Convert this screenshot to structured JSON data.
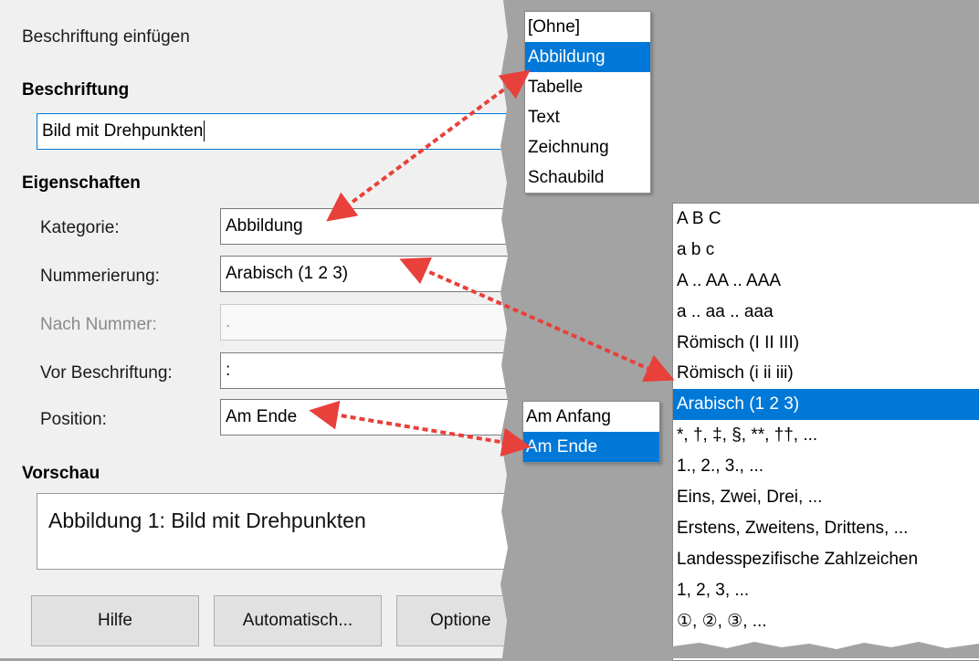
{
  "dialog": {
    "title": "Beschriftung einfügen",
    "section_caption": "Beschriftung",
    "caption_value": "Bild mit Drehpunkten",
    "section_properties": "Eigenschaften",
    "fields": {
      "category_label": "Kategorie:",
      "category_value": "Abbildung",
      "numbering_label": "Nummerierung:",
      "numbering_value": "Arabisch (1 2 3)",
      "after_number_label": "Nach Nummer:",
      "after_number_value": ".",
      "before_caption_label": "Vor Beschriftung:",
      "before_caption_value": ":",
      "position_label": "Position:",
      "position_value": "Am Ende"
    },
    "section_preview": "Vorschau",
    "preview_text": "Abbildung 1: Bild mit Drehpunkten",
    "buttons": {
      "help": "Hilfe",
      "autocaption": "Automatisch...",
      "options": "Optione"
    }
  },
  "category_list": [
    "[Ohne]",
    "Abbildung",
    "Tabelle",
    "Text",
    "Zeichnung",
    "Schaubild"
  ],
  "category_selected_index": 1,
  "position_list": [
    "Am Anfang",
    "Am Ende"
  ],
  "position_selected_index": 1,
  "numbering_list": [
    "A B C",
    "a b c",
    "A .. AA .. AAA",
    "a .. aa .. aaa",
    "Römisch (I II III)",
    "Römisch (i ii iii)",
    "Arabisch (1 2 3)",
    "*, †, ‡, §, **, ††, ...",
    "1., 2., 3., ...",
    "Eins, Zwei, Drei, ...",
    "Erstens, Zweitens, Drittens, ...",
    "Landesspezifische Zahlzeichen",
    "1, 2, 3, ...",
    "①, ②, ③, ..."
  ],
  "numbering_selected_index": 6,
  "colors": {
    "selection": "#0078d7",
    "arrow": "#e8403a",
    "background": "#a3a3a3"
  }
}
